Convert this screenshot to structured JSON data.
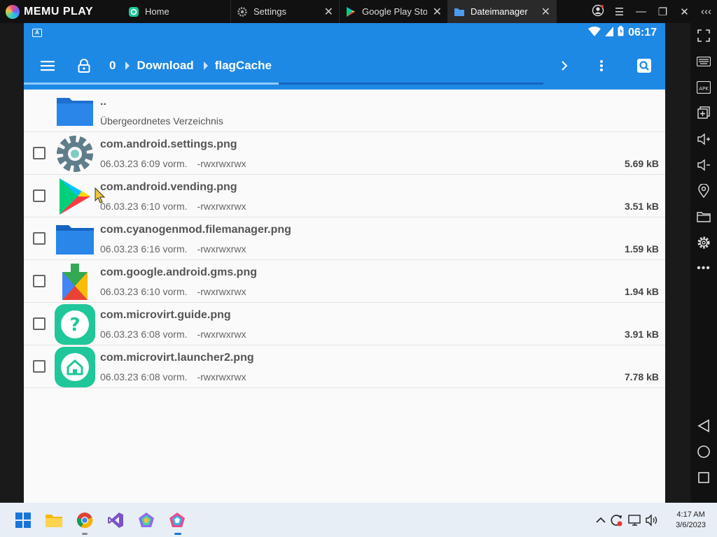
{
  "app": {
    "brand": "MEMU PLAY"
  },
  "tabs": [
    {
      "label": "Home",
      "icon": "home-app-icon",
      "active": false
    },
    {
      "label": "Settings",
      "icon": "gear-icon",
      "active": false
    },
    {
      "label": "Google Play Stor",
      "icon": "play-store-icon",
      "active": false
    },
    {
      "label": "Dateimanager",
      "icon": "folder-icon",
      "active": true
    }
  ],
  "android": {
    "status": {
      "time": "06:17"
    },
    "appbar": {
      "breadcrumb": [
        "0",
        "Download",
        "flagCache"
      ],
      "progress": 0.49
    },
    "parent": {
      "name": "..",
      "label": "Übergeordnetes Verzeichnis"
    },
    "files": [
      {
        "name": "com.android.settings.png",
        "date": "06.03.23 6:09 vorm.",
        "perm": "-rwxrwxrwx",
        "size": "5.69 kB",
        "icon": "settings-gear-icon"
      },
      {
        "name": "com.android.vending.png",
        "date": "06.03.23 6:10 vorm.",
        "perm": "-rwxrwxrwx",
        "size": "3.51 kB",
        "icon": "play-store-icon"
      },
      {
        "name": "com.cyanogenmod.filemanager.png",
        "date": "06.03.23 6:16 vorm.",
        "perm": "-rwxrwxrwx",
        "size": "1.59 kB",
        "icon": "folder-icon"
      },
      {
        "name": "com.google.android.gms.png",
        "date": "06.03.23 6:10 vorm.",
        "perm": "-rwxrwxrwx",
        "size": "1.94 kB",
        "icon": "play-services-icon"
      },
      {
        "name": "com.microvirt.guide.png",
        "date": "06.03.23 6:08 vorm.",
        "perm": "-rwxrwxrwx",
        "size": "3.91 kB",
        "icon": "question-icon"
      },
      {
        "name": "com.microvirt.launcher2.png",
        "date": "06.03.23 6:08 vorm.",
        "perm": "-rwxrwxrwx",
        "size": "7.78 kB",
        "icon": "home-icon"
      }
    ]
  },
  "taskbar": {
    "time": "4:17 AM",
    "date": "3/6/2023"
  },
  "colors": {
    "accent": "#1e88e5",
    "teal": "#1fc79a"
  }
}
